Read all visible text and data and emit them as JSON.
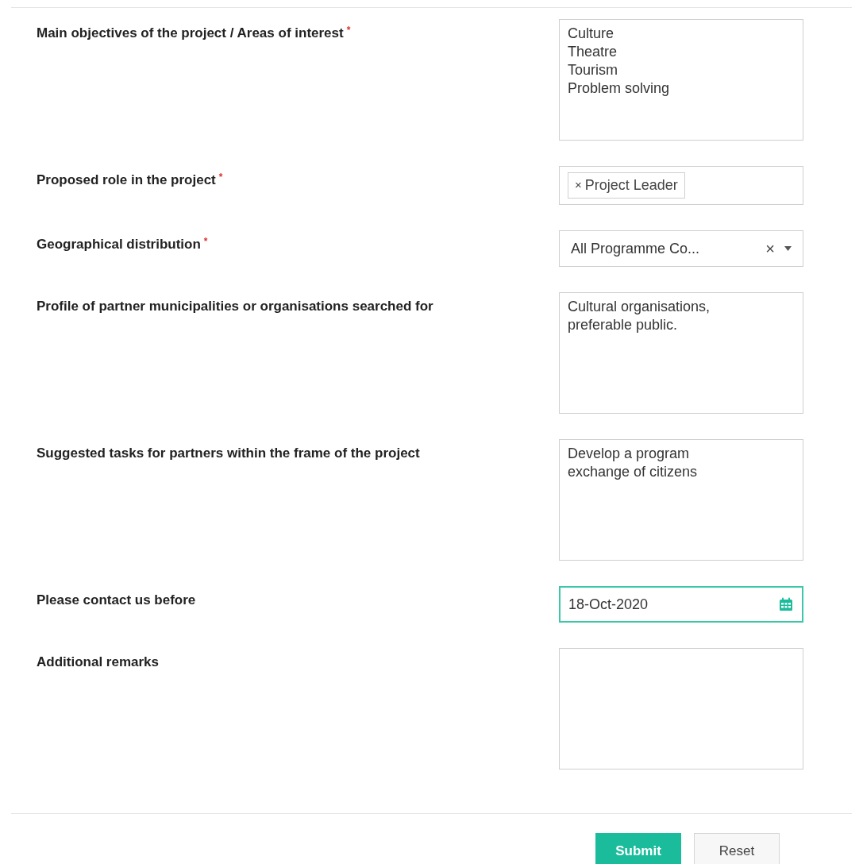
{
  "fields": [
    {
      "label": "Main objectives of the project / Areas of interest",
      "required": true,
      "kind": "textarea",
      "value": "Culture\nTheatre\nTourism\nProblem solving"
    },
    {
      "label": "Proposed role in the project",
      "required": true,
      "kind": "tags",
      "tags": [
        "Project Leader"
      ],
      "remove_symbol": "×"
    },
    {
      "label": "Geographical distribution",
      "required": true,
      "kind": "select",
      "value": "All Programme Co...",
      "clear_symbol": "×"
    },
    {
      "label": "Profile of partner municipalities or organisations searched for",
      "required": false,
      "kind": "textarea",
      "value": "Cultural organisations,\npreferable public."
    },
    {
      "label": "Suggested tasks for partners within the frame of the project",
      "required": false,
      "kind": "textarea",
      "value": "Develop a program\nexchange of citizens"
    },
    {
      "label": "Please contact us before",
      "required": false,
      "kind": "date",
      "value": "18-Oct-2020",
      "focused": true
    },
    {
      "label": "Additional remarks",
      "required": false,
      "kind": "textarea"
    }
  ],
  "required_mark": "*",
  "buttons": [
    {
      "label": "Submit",
      "kind": "primary"
    },
    {
      "label": "Reset",
      "kind": "secondary"
    }
  ]
}
